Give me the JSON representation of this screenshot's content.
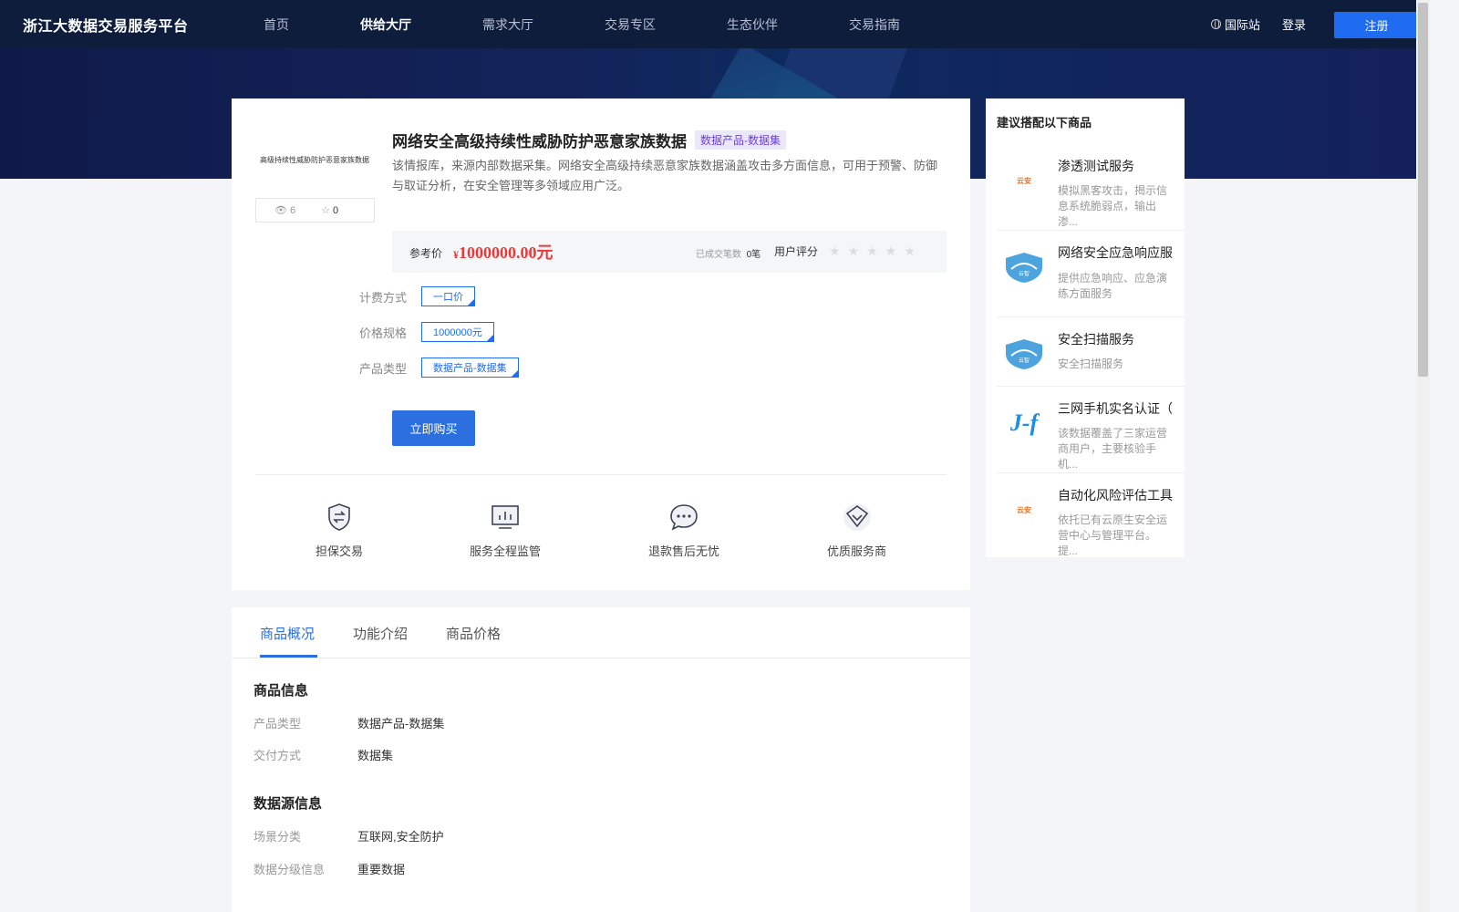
{
  "header": {
    "logo": "浙江大数据交易服务平台",
    "nav": [
      "首页",
      "供给大厅",
      "需求大厅",
      "交易专区",
      "生态伙伴",
      "交易指南"
    ],
    "active_nav": 1,
    "intl": "国际站",
    "login": "登录",
    "register": "注册"
  },
  "product": {
    "thumb_text": "高级持续性威胁防护恶意家族数据",
    "views": "6",
    "favorites": "0",
    "title": "网络安全高级持续性威胁防护恶意家族数据",
    "tag": "数据产品-数据集",
    "description": "该情报库，来源内部数据采集。网络安全高级持续恶意家族数据涵盖攻击多方面信息，可用于预警、防御与取证分析，在安全管理等多领域应用广泛。",
    "price_label": "参考价",
    "currency": "¥",
    "price": "1000000.00元",
    "deals_label": "已成交笔数",
    "deals_count": "0笔",
    "rating_label": "用户评分",
    "rating_stars": "★★★★★",
    "rating_value": 0,
    "options": [
      {
        "label": "计费方式",
        "value": "一口价"
      },
      {
        "label": "价格规格",
        "value": "1000000元"
      },
      {
        "label": "产品类型",
        "value": "数据产品-数据集"
      }
    ],
    "buy_label": "立即购买",
    "features": [
      "担保交易",
      "服务全程监管",
      "退款售后无忧",
      "优质服务商"
    ]
  },
  "tabs": {
    "items": [
      "商品概况",
      "功能介绍",
      "商品价格"
    ],
    "active": 0
  },
  "details": {
    "product_info_title": "商品信息",
    "product_info": [
      {
        "k": "产品类型",
        "v": "数据产品-数据集"
      },
      {
        "k": "交付方式",
        "v": "数据集"
      }
    ],
    "source_info_title": "数据源信息",
    "source_info": [
      {
        "k": "场景分类",
        "v": "互联网,安全防护"
      },
      {
        "k": "数据分级信息",
        "v": "重要数据"
      }
    ]
  },
  "sidebar": {
    "title": "建议搭配以下商品",
    "items": [
      {
        "name": "渗透测试服务",
        "desc": "模拟黑客攻击，揭示信息系统脆弱点，输出渗...",
        "logo": "云安"
      },
      {
        "name": "网络安全应急响应服",
        "desc": "提供应急响应、应急演练方面服务",
        "logo": "云智"
      },
      {
        "name": "安全扫描服务",
        "desc": "安全扫描服务",
        "logo": "云智"
      },
      {
        "name": "三网手机实名认证（",
        "desc": "该数据覆盖了三家运营商用户，主要核验手机...",
        "logo": "J-f"
      },
      {
        "name": "自动化风险评估工具",
        "desc": "依托已有云原生安全运营中心与管理平台。提...",
        "logo": "云安"
      }
    ]
  },
  "colors": {
    "header_bg": "#0f1d3d",
    "primary": "#2b6fe0",
    "price": "#e93a3a",
    "tag_text": "#6b3fd6"
  }
}
